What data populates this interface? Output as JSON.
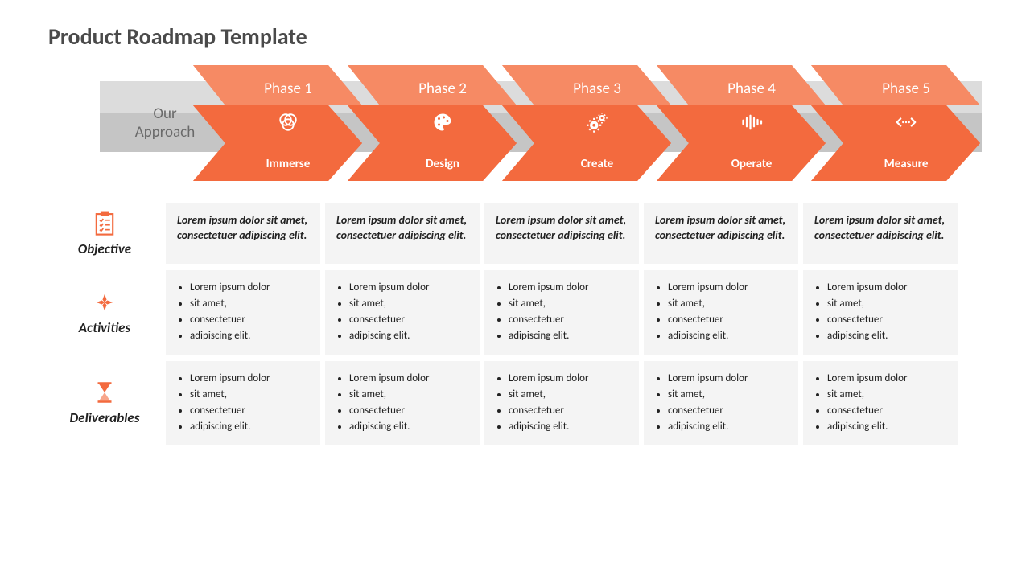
{
  "title": "Product Roadmap Template",
  "approach_l1": "Our",
  "approach_l2": "Approach",
  "phases": [
    {
      "label": "Phase 1",
      "name": "Immerse",
      "icon": "venn"
    },
    {
      "label": "Phase 2",
      "name": "Design",
      "icon": "palette"
    },
    {
      "label": "Phase 3",
      "name": "Create",
      "icon": "gears"
    },
    {
      "label": "Phase 4",
      "name": "Operate",
      "icon": "soundwave"
    },
    {
      "label": "Phase 5",
      "name": "Measure",
      "icon": "expand"
    }
  ],
  "rows": [
    {
      "label": "Objective",
      "icon": "checklist",
      "type": "text",
      "cells": [
        "Lorem ipsum dolor sit amet, consectetuer adipiscing elit.",
        "Lorem ipsum dolor sit amet, consectetuer adipiscing elit.",
        "Lorem ipsum dolor sit amet, consectetuer adipiscing elit.",
        "Lorem ipsum dolor sit amet, consectetuer adipiscing elit.",
        "Lorem ipsum dolor sit amet, consectetuer adipiscing elit."
      ]
    },
    {
      "label": "Activities",
      "icon": "hands",
      "type": "list",
      "cells": [
        [
          "Lorem ipsum dolor",
          "sit amet,",
          "consectetuer",
          "adipiscing elit."
        ],
        [
          "Lorem ipsum dolor",
          "sit amet,",
          "consectetuer",
          "adipiscing elit."
        ],
        [
          "Lorem ipsum dolor",
          "sit amet,",
          "consectetuer",
          "adipiscing elit."
        ],
        [
          "Lorem ipsum dolor",
          "sit amet,",
          "consectetuer",
          "adipiscing elit."
        ],
        [
          "Lorem ipsum dolor",
          "sit amet,",
          "consectetuer",
          "adipiscing elit."
        ]
      ]
    },
    {
      "label": "Deliverables",
      "icon": "hourglass",
      "type": "list",
      "cells": [
        [
          "Lorem ipsum dolor",
          "sit amet,",
          "consectetuer",
          "adipiscing elit."
        ],
        [
          "Lorem ipsum dolor",
          "sit amet,",
          "consectetuer",
          "adipiscing elit."
        ],
        [
          "Lorem ipsum dolor",
          "sit amet,",
          "consectetuer",
          "adipiscing elit."
        ],
        [
          "Lorem ipsum dolor",
          "sit amet,",
          "consectetuer",
          "adipiscing elit."
        ],
        [
          "Lorem ipsum dolor",
          "sit amet,",
          "consectetuer",
          "adipiscing elit."
        ]
      ]
    }
  ],
  "colors": {
    "accent": "#f36a3e",
    "accent_light": "#f68a64",
    "accent_dark": "#e85a2c"
  }
}
